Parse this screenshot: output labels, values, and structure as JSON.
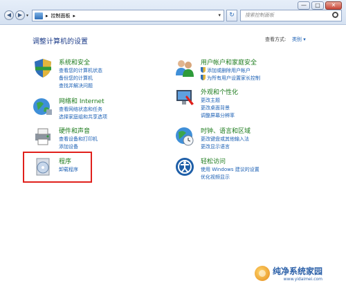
{
  "window": {
    "min_label": "—",
    "max_label": "□",
    "close_label": "✕"
  },
  "nav": {
    "back_glyph": "◀",
    "fwd_glyph": "▶",
    "dropdown_glyph": "▾"
  },
  "address": {
    "sep1": "▸",
    "path": "控制面板",
    "sep2": "▸",
    "dropdown": "▾",
    "refresh_glyph": "↻"
  },
  "search": {
    "placeholder": "搜索控制面板"
  },
  "heading": "调整计算机的设置",
  "view_by": {
    "label": "查看方式:",
    "value": "类别 ▾"
  },
  "categories": {
    "system": {
      "title": "系统和安全",
      "links": [
        "查看您的计算机状态",
        "备份您的计算机",
        "查找并解决问题"
      ]
    },
    "network": {
      "title": "网络和 Internet",
      "links": [
        "查看网络状态和任务",
        "选择家庭组和共享选项"
      ]
    },
    "hardware": {
      "title": "硬件和声音",
      "links": [
        "查看设备和打印机",
        "添加设备"
      ]
    },
    "programs": {
      "title": "程序",
      "links": [
        "卸载程序"
      ]
    },
    "users": {
      "title": "用户帐户和家庭安全",
      "links": [
        "添加或删除用户帐户",
        "为所有用户设置家长控制"
      ]
    },
    "appearance": {
      "title": "外观和个性化",
      "links": [
        "更改主题",
        "更改桌面背景",
        "调整屏幕分辨率"
      ]
    },
    "clock": {
      "title": "时钟、语言和区域",
      "links": [
        "更改键盘或其他输入法",
        "更改显示语言"
      ]
    },
    "ease": {
      "title": "轻松访问",
      "links": [
        "使用 Windows 建议的设置",
        "优化视频显示"
      ]
    }
  },
  "watermark": {
    "title": "纯净系统家园",
    "url": "www.yidaimei.com"
  },
  "colors": {
    "link": "#1a5fb4",
    "category_title": "#1d7b1d",
    "heading": "#1e3d8a",
    "highlight": "#e0201b"
  }
}
